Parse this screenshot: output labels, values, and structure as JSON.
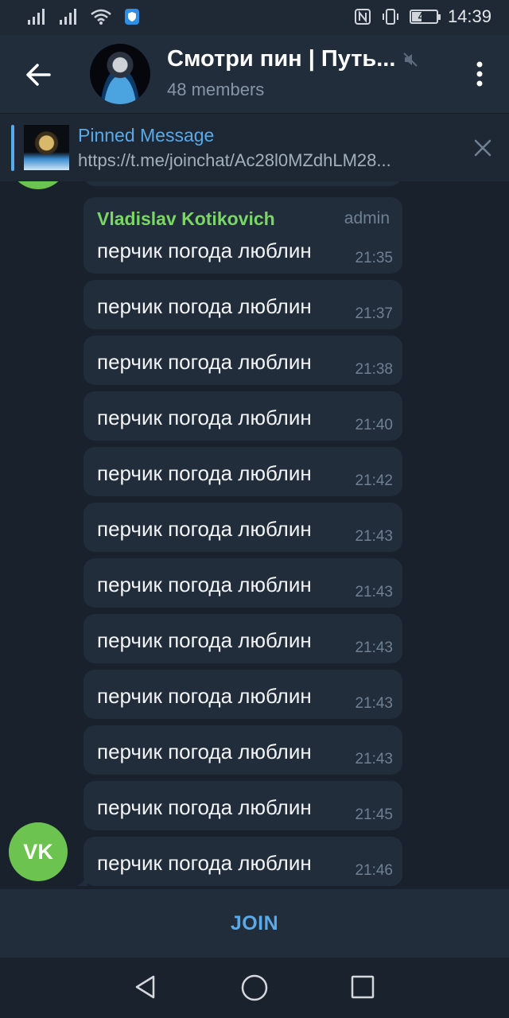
{
  "status": {
    "time": "14:39",
    "battery": "45",
    "battery_fraction": 0.45
  },
  "header": {
    "title": "Смотри пин | Путь...",
    "subtitle": "48 members",
    "back_icon": "arrow-back-icon",
    "mute_icon": "muted-icon",
    "menu_icon": "more-vert-icon"
  },
  "pinned": {
    "title": "Pinned Message",
    "text": "https://t.me/joinchat/Ac28l0MZdhLM28..."
  },
  "messages": [
    {
      "sender": "Vladislav Kotikovich",
      "role": "admin",
      "text": "перчик погода люблин",
      "time": "21:35"
    },
    {
      "text": "перчик погода люблин",
      "time": "21:37"
    },
    {
      "text": "перчик погода люблин",
      "time": "21:38"
    },
    {
      "text": "перчик погода люблин",
      "time": "21:40"
    },
    {
      "text": "перчик погода люблин",
      "time": "21:42"
    },
    {
      "text": "перчик погода люблин",
      "time": "21:43"
    },
    {
      "text": "перчик погода люблин",
      "time": "21:43"
    },
    {
      "text": "перчик погода люблин",
      "time": "21:43"
    },
    {
      "text": "перчик погода люблин",
      "time": "21:43"
    },
    {
      "text": "перчик погода люблин",
      "time": "21:43"
    },
    {
      "text": "перчик погода люблин",
      "time": "21:45"
    },
    {
      "text": "перчик погода люблин",
      "time": "21:46"
    }
  ],
  "avatar_initials": "VK",
  "join_label": "JOIN",
  "colors": {
    "accent": "#5aa9e8",
    "sender_name": "#7bd764",
    "avatar": "#6cc34f",
    "bubble": "#212d3b",
    "background": "#18212c"
  }
}
